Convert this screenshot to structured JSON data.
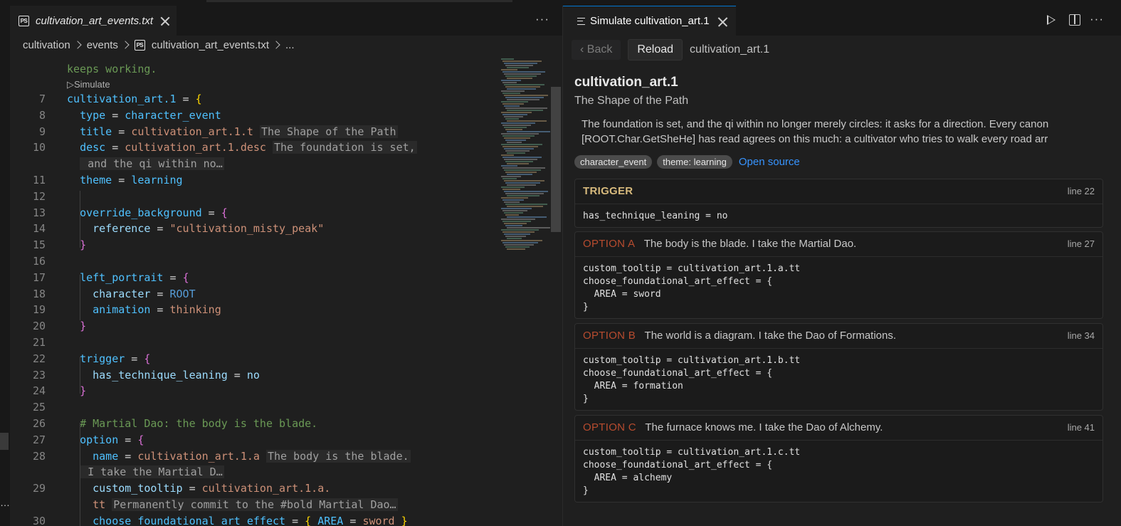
{
  "left": {
    "tab_label": "cultivation_art_events.txt",
    "tab_icon": "PS",
    "breadcrumb": [
      "cultivation",
      "events",
      "cultivation_art_events.txt",
      "..."
    ],
    "codelens": "▷Simulate",
    "lines": [
      {
        "n": "",
        "text": "keeps working."
      },
      {
        "n": "7",
        "text": "cultivation_art.1 = {"
      },
      {
        "n": "8",
        "text": "  type = character_event"
      },
      {
        "n": "9",
        "text": "  title = cultivation_art.1.t",
        "hint": "The Shape of the Path"
      },
      {
        "n": "10",
        "text": "  desc = cultivation_art.1.desc",
        "hint": "The foundation is set,"
      },
      {
        "n": "",
        "text": "",
        "hint": " and the qi within no…"
      },
      {
        "n": "11",
        "text": "  theme = learning"
      },
      {
        "n": "12",
        "text": ""
      },
      {
        "n": "13",
        "text": "  override_background = {"
      },
      {
        "n": "14",
        "text": "    reference = \"cultivation_misty_peak\""
      },
      {
        "n": "15",
        "text": "  }"
      },
      {
        "n": "16",
        "text": ""
      },
      {
        "n": "17",
        "text": "  left_portrait = {"
      },
      {
        "n": "18",
        "text": "    character = ROOT"
      },
      {
        "n": "19",
        "text": "    animation = thinking"
      },
      {
        "n": "20",
        "text": "  }"
      },
      {
        "n": "21",
        "text": ""
      },
      {
        "n": "22",
        "text": "  trigger = {"
      },
      {
        "n": "23",
        "text": "    has_technique_leaning = no"
      },
      {
        "n": "24",
        "text": "  }"
      },
      {
        "n": "25",
        "text": ""
      },
      {
        "n": "26",
        "text": "  # Martial Dao: the body is the blade."
      },
      {
        "n": "27",
        "text": "  option = {"
      },
      {
        "n": "28",
        "text": "    name = cultivation_art.1.a",
        "hint": "The body is the blade."
      },
      {
        "n": "",
        "text": "",
        "hint": " I take the Martial D…"
      },
      {
        "n": "29",
        "text": "    custom_tooltip = cultivation_art.1.a."
      },
      {
        "n": "",
        "text": "    tt",
        "hint": "Permanently commit to the #bold Martial Dao…"
      },
      {
        "n": "30",
        "text": "    choose_foundational_art_effect = { AREA = sword }"
      }
    ]
  },
  "right": {
    "tab_label": "Simulate cultivation_art.1",
    "back_label": "‹ Back",
    "reload_label": "Reload",
    "event_id": "cultivation_art.1",
    "title": "cultivation_art.1",
    "subtitle": "The Shape of the Path",
    "desc_line1": "The foundation is set, and the qi within no longer merely circles: it asks for a direction. Every canon",
    "desc_line2": "[ROOT.Char.GetSheHe] has read agrees on this much: a cultivator who tries to walk every road arr",
    "tags": [
      "character_event",
      "theme: learning"
    ],
    "open_source": "Open source",
    "trigger": {
      "label": "TRIGGER",
      "line": "line 22",
      "body": "has_technique_leaning = no"
    },
    "options": [
      {
        "label": "OPTION A",
        "title": "The body is the blade. I take the Martial Dao.",
        "line": "line 27",
        "body": "custom_tooltip = cultivation_art.1.a.tt\nchoose_foundational_art_effect = {\n  AREA = sword\n}"
      },
      {
        "label": "OPTION B",
        "title": "The world is a diagram. I take the Dao of Formations.",
        "line": "line 34",
        "body": "custom_tooltip = cultivation_art.1.b.tt\nchoose_foundational_art_effect = {\n  AREA = formation\n}"
      },
      {
        "label": "OPTION C",
        "title": "The furnace knows me. I take the Dao of Alchemy.",
        "line": "line 41",
        "body": "custom_tooltip = cultivation_art.1.c.tt\nchoose_foundational_art_effect = {\n  AREA = alchemy\n}"
      }
    ]
  }
}
